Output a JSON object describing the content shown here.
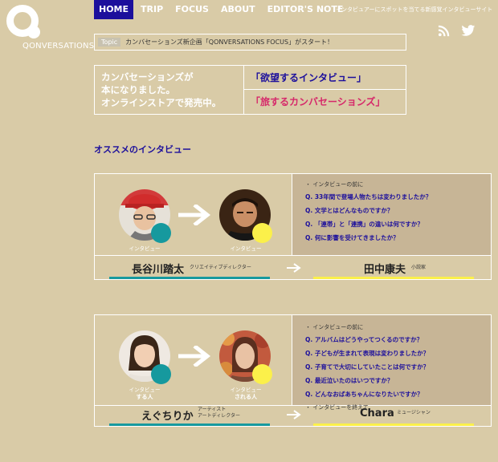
{
  "brand": {
    "name": "QONVERSATIONS"
  },
  "nav": {
    "items": [
      "HOME",
      "TRIP",
      "FOCUS",
      "ABOUT",
      "EDITOR'S NOTE"
    ],
    "active": "HOME"
  },
  "tagline": "インタビュアーにスポットを当てる新感覚インタビューサイト",
  "social": {
    "rss": "rss-icon",
    "twitter": "twitter-icon"
  },
  "topic": {
    "label": "Topic",
    "text": "カンバセーションズ新企画「QONVERSATIONS FOCUS」がスタート！"
  },
  "banner": {
    "line1": "カンバセーションズが",
    "line2": "本になりました。",
    "line3": "オンラインストアで発売中。",
    "book1": "「欲望するインタビュー」",
    "book2": "「旅するカンバセーションズ」"
  },
  "section": {
    "heading": "オススメのインタビュー"
  },
  "cards": [
    {
      "interviewer_caption": "インタビュー",
      "interviewer_caption_sub": "",
      "interviewee_caption": "インタビュー",
      "interviewee_caption_sub": "",
      "question_head": "・ インタビューの前に",
      "questions": [
        "Q. 33年間で登場人物たちは変わりましたか？",
        "Q. 文学とはどんなものですか？",
        "Q. 「連帯」と「連携」の違いは何ですか？",
        "Q. 何に影響を受けてきましたか？"
      ],
      "question_foot": "",
      "interviewer_name": "長谷川踏太",
      "interviewer_role": "クリエイティブディレクター",
      "interviewee_name": "田中康夫",
      "interviewee_role": "小説家"
    },
    {
      "interviewer_caption": "インタビュー",
      "interviewer_caption_sub": "する人",
      "interviewee_caption": "インタビュー",
      "interviewee_caption_sub": "される人",
      "question_head": "・ インタビューの前に",
      "questions": [
        "Q. アルバムはどうやってつくるのですか？",
        "Q. 子どもが生まれて表現は変わりましたか？",
        "Q. 子育てで大切にしていたことは何ですか？",
        "Q. 最近泣いたのはいつですか？",
        "Q. どんなおばあちゃんになりたいですか？"
      ],
      "question_foot": "・ インタビューを終えて",
      "interviewer_name": "えぐちりか",
      "interviewer_role": "アーティスト",
      "interviewer_role2": "アートディレクター",
      "interviewee_name": "Chara",
      "interviewee_role": "ミュージシャン"
    }
  ],
  "colors": {
    "background": "#d9cba7",
    "accent": "#1c0f9c",
    "pink": "#d6286a",
    "teal": "#16999e",
    "yellow": "#fbf04a"
  }
}
